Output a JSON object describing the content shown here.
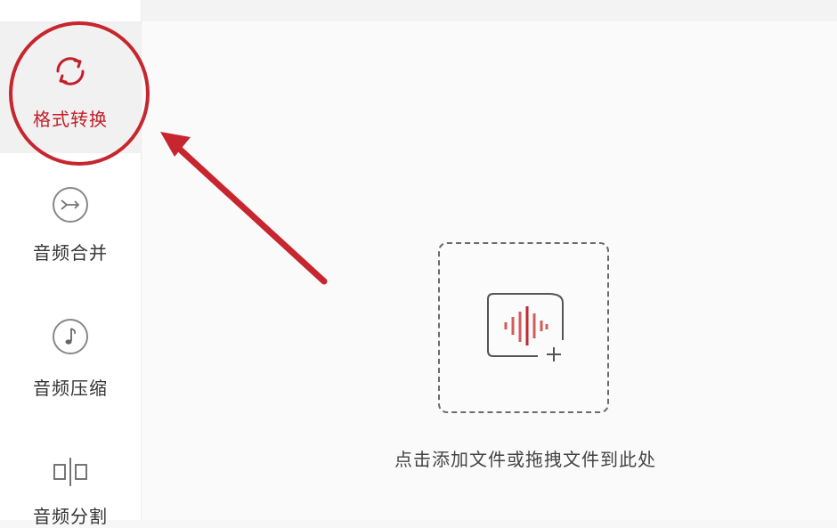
{
  "sidebar": {
    "items": [
      {
        "label": "格式转换",
        "icon": "refresh-icon",
        "active": true
      },
      {
        "label": "音频合并",
        "icon": "merge-icon",
        "active": false
      },
      {
        "label": "音频压缩",
        "icon": "music-note-icon",
        "active": false
      },
      {
        "label": "音频分割",
        "icon": "split-icon",
        "active": false
      }
    ]
  },
  "main": {
    "dropzone_icon": "audio-add-icon",
    "hint": "点击添加文件或拖拽文件到此处"
  },
  "colors": {
    "accent": "#c7262f",
    "text": "#333333"
  }
}
